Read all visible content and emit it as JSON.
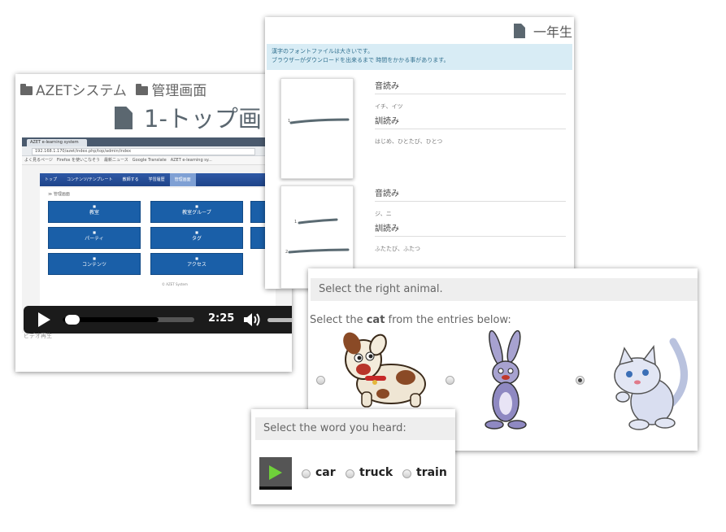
{
  "admin_card": {
    "breadcrumb": [
      "AZETシステム",
      "管理画面"
    ],
    "title": "1-トップ画",
    "browser": {
      "tab_title": "AZET e-learning system",
      "url": "192.168.1.170/azet/index.php/top/admin/index",
      "bookmarks": "よく見るページ　Firefox を使いこなそう　最新ニュース　Google Translate　AZET e-learning sy..."
    },
    "site_nav": [
      "トップ",
      "コンテンツ/テンプレート",
      "教師する",
      "学習履歴",
      "管理画面"
    ],
    "site_nav_active": 4,
    "site_breadcrumb": "≫ 管理画面",
    "tiles": [
      "教室",
      "教室グループ",
      "",
      "パーティ",
      "タグ",
      "",
      "コンテンツ",
      "アクセス"
    ],
    "site_footer": "© AZET System",
    "video": {
      "time": "2:25",
      "progress": 0.02,
      "buffered": 0.73
    },
    "caption": "ビデオ再生"
  },
  "kanji_card": {
    "grade": "一年生",
    "notice": [
      "漢字のフォントファイルは大きいです。",
      "ブラウザーがダウンロードを出来るまで 時間をかかる事があります。"
    ],
    "entries": [
      {
        "on_label": "音読み",
        "on_value": "イチ、イツ",
        "kun_label": "訓読み",
        "kun_value": "はじめ、ひとたび、ひとつ",
        "stroke_numbers": [
          "1"
        ]
      },
      {
        "on_label": "音読み",
        "on_value": "ジ、ニ",
        "kun_label": "訓読み",
        "kun_value": "ふたたび、ふたつ",
        "stroke_numbers": [
          "1",
          "2"
        ]
      }
    ]
  },
  "animal_card": {
    "header": "Select the right animal.",
    "instruction_before": "Select the ",
    "instruction_bold": "cat",
    "instruction_after": " from the entries below:",
    "options": [
      {
        "name": "dog-option",
        "checked": false
      },
      {
        "name": "rabbit-option",
        "checked": false
      },
      {
        "name": "cat-option",
        "checked": true
      }
    ]
  },
  "word_card": {
    "header": "Select the word you heard:",
    "options": [
      "car",
      "truck",
      "train"
    ]
  },
  "colors": {
    "site_nav": "#1f4489",
    "tile": "#1a5fa8",
    "notice_bg": "#d8ecf5",
    "play_green": "#6fd03a"
  }
}
